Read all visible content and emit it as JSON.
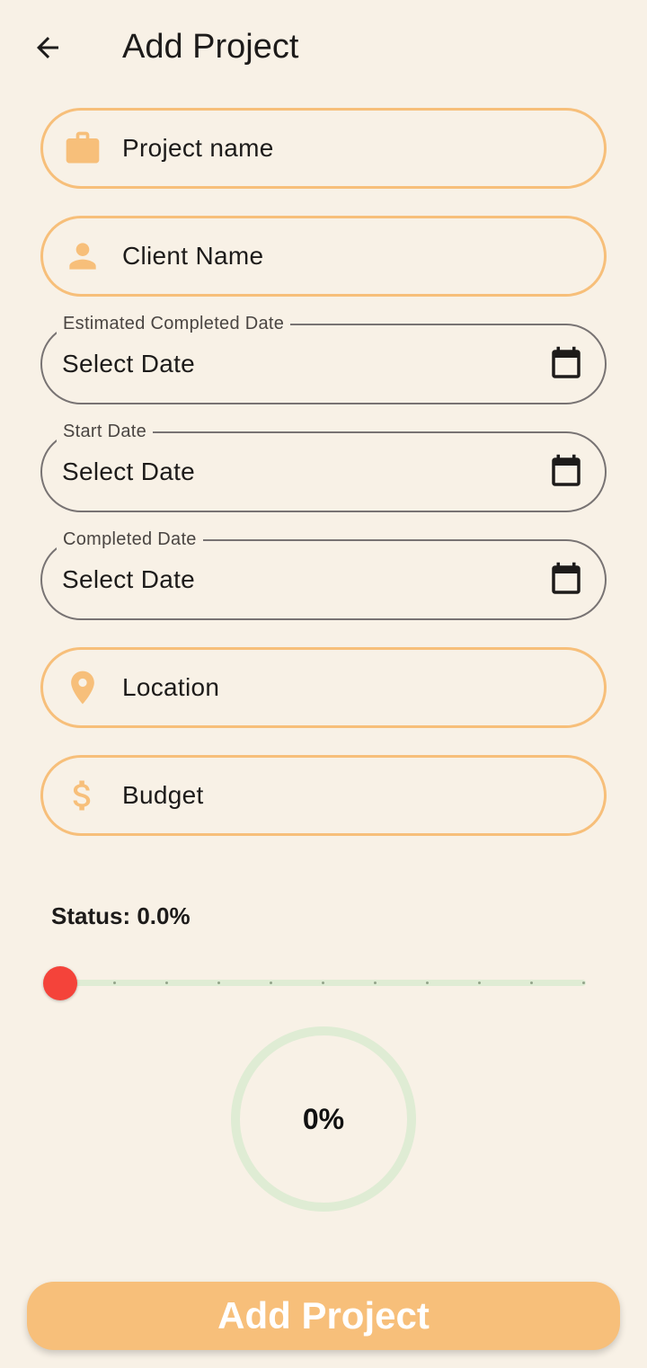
{
  "header": {
    "title": "Add Project",
    "back_icon": "arrow-back-icon"
  },
  "fields": {
    "project_name": {
      "placeholder": "Project name",
      "icon": "briefcase-icon"
    },
    "client_name": {
      "placeholder": "Client Name",
      "icon": "person-icon"
    },
    "estimated_completed_date": {
      "label": "Estimated Completed Date",
      "value": "Select Date",
      "icon": "calendar-icon"
    },
    "start_date": {
      "label": "Start Date",
      "value": "Select Date",
      "icon": "calendar-icon"
    },
    "completed_date": {
      "label": "Completed Date",
      "value": "Select Date",
      "icon": "calendar-icon"
    },
    "location": {
      "placeholder": "Location",
      "icon": "location-pin-icon"
    },
    "budget": {
      "placeholder": "Budget",
      "icon": "dollar-icon"
    }
  },
  "status": {
    "label": "Status: 0.0%",
    "value": 0.0,
    "divisions": 10
  },
  "progress": {
    "label": "0%",
    "value": 0
  },
  "submit": {
    "label": "Add Project"
  },
  "colors": {
    "background": "#f8f1e6",
    "accent": "#f7bf7a",
    "slider_thumb": "#f4433a",
    "track": "#dfecd4"
  }
}
